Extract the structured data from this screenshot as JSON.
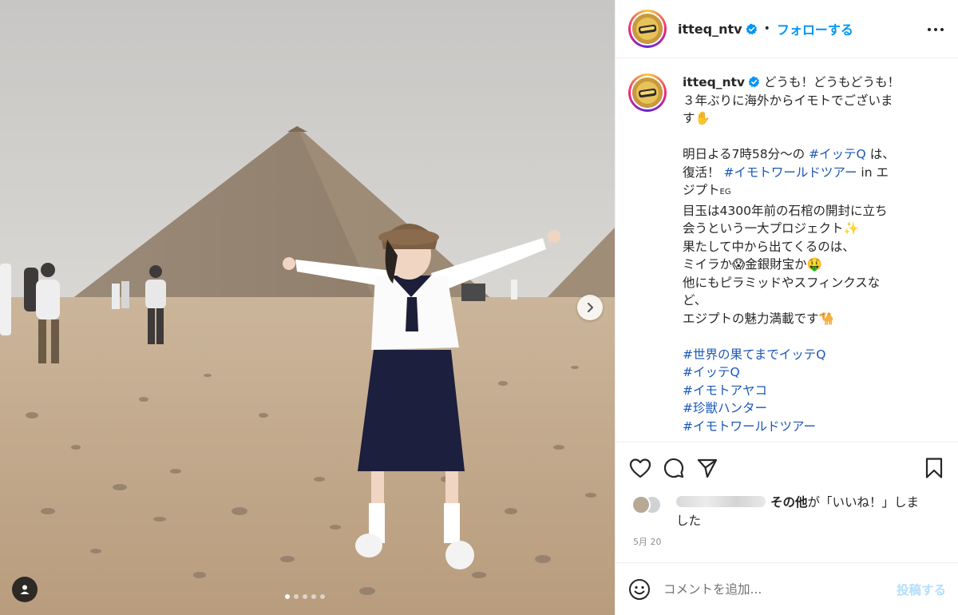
{
  "post": {
    "username": "itteq_ntv",
    "follow_label": "フォローする",
    "separator": "•"
  },
  "caption": {
    "lines": [
      {
        "parts": [
          {
            "t": "どうも！どうもどうも！"
          }
        ]
      },
      {
        "parts": [
          {
            "t": "３年ぶりに海外からイモトでございま"
          }
        ]
      },
      {
        "parts": [
          {
            "t": "す✋"
          }
        ]
      },
      {
        "spacer": true
      },
      {
        "parts": [
          {
            "t": "明日よる7時58分〜の "
          },
          {
            "t": "#イッテQ",
            "tag": true
          },
          {
            "t": " は、"
          }
        ]
      },
      {
        "parts": [
          {
            "t": "復活！ "
          },
          {
            "t": "#イモトワールドツアー",
            "tag": true
          },
          {
            "t": " in エ"
          }
        ]
      },
      {
        "parts": [
          {
            "t": "ジプト"
          },
          {
            "t": "EG",
            "small": true
          }
        ]
      },
      {
        "parts": [
          {
            "t": "目玉は4300年前の石棺の開封に立ち"
          }
        ]
      },
      {
        "parts": [
          {
            "t": "会うという一大プロジェクト✨"
          }
        ]
      },
      {
        "parts": [
          {
            "t": "果たして中から出てくるのは、"
          }
        ]
      },
      {
        "parts": [
          {
            "t": "ミイラか😱金銀財宝か🤑"
          }
        ]
      },
      {
        "parts": [
          {
            "t": "他にもピラミッドやスフィンクスな"
          }
        ]
      },
      {
        "parts": [
          {
            "t": "ど、"
          }
        ]
      },
      {
        "parts": [
          {
            "t": "エジプトの魅力満載です🐪"
          }
        ]
      },
      {
        "spacer": true
      },
      {
        "parts": [
          {
            "t": "#世界の果てまでイッテQ",
            "tag": true
          }
        ]
      },
      {
        "parts": [
          {
            "t": "#イッテQ",
            "tag": true
          }
        ]
      },
      {
        "parts": [
          {
            "t": "#イモトアヤコ",
            "tag": true
          }
        ]
      },
      {
        "parts": [
          {
            "t": "#珍獣ハンター",
            "tag": true
          }
        ]
      },
      {
        "parts": [
          {
            "t": "#イモトワールドツアー",
            "tag": true
          }
        ]
      }
    ]
  },
  "likes": {
    "others_label": "その他",
    "suffix_1": "が「いいね！」しま",
    "suffix_2": "した"
  },
  "date": "5月 20",
  "comment": {
    "placeholder": "コメントを追加...",
    "post_label": "投稿する"
  },
  "carousel": {
    "dot_count": 5,
    "active_index": 0
  },
  "colors": {
    "link": "#1a57b8",
    "follow": "#0095f6",
    "post_disabled": "#b2dffc",
    "verified": "#0095f6"
  },
  "icons": [
    "verified-icon",
    "more-options-icon",
    "heart-icon",
    "comment-icon",
    "share-icon",
    "bookmark-icon",
    "emoji-icon",
    "chevron-right-icon",
    "user-tag-icon"
  ]
}
